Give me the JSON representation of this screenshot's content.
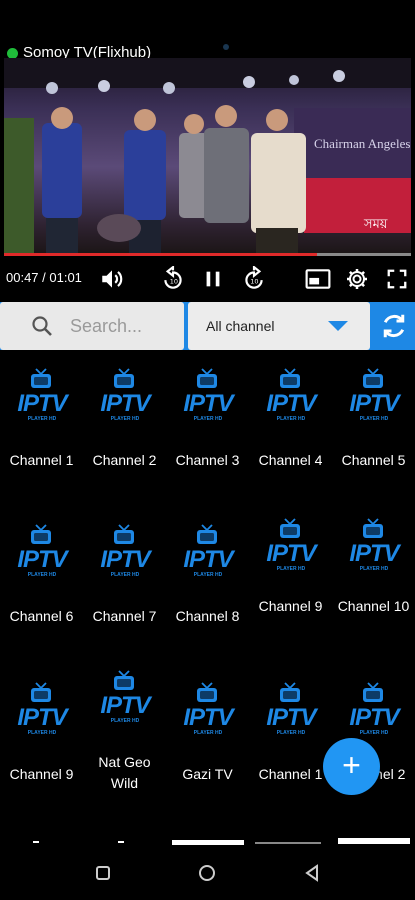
{
  "header": {
    "title": "Somoy TV(Flixhub)"
  },
  "player": {
    "time": "00:47 / 01:01",
    "progress": 0.77,
    "banner_text": "Chairman Angeles",
    "banner_sub": "সময়"
  },
  "search": {
    "placeholder": "Search..."
  },
  "filter": {
    "selected": "All channel"
  },
  "logo": {
    "main": "IPTV",
    "sub": "PLAYER HD"
  },
  "channels": [
    "Channel 1",
    "Channel 2",
    "Channel 3",
    "Channel 4",
    "Channel 5",
    "Channel 6",
    "Channel 7",
    "Channel 8",
    "Channel 9",
    "Channel 10",
    "Channel 9",
    "Nat Geo Wild",
    "Gazi TV",
    "Channel 1",
    "Channel 2"
  ],
  "colors": {
    "accent": "#1e88e5",
    "live": "#1fbd3a",
    "progress": "#e02a2a"
  }
}
